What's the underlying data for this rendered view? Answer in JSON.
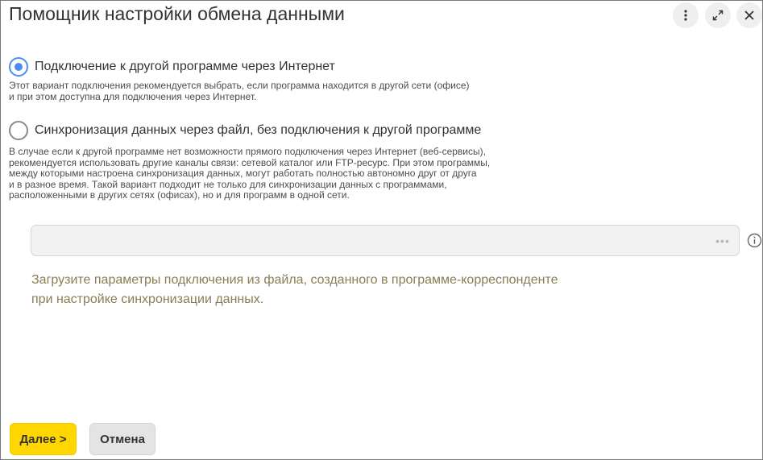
{
  "window": {
    "title": "Помощник настройки обмена данными"
  },
  "header_buttons": {
    "more": "more-vertical-icon",
    "expand": "expand-icon",
    "close": "close-icon"
  },
  "options": [
    {
      "label": "Подключение к другой программе через Интернет",
      "selected": true,
      "description_lines": [
        "Этот вариант подключения рекомендуется выбрать, если программа находится в другой сети (офисе)",
        "и при этом доступна для подключения через Интернет."
      ]
    },
    {
      "label": "Синхронизация данных через файл, без подключения к другой программе",
      "selected": false,
      "description_lines": [
        "В случае если к другой программе нет возможности прямого подключения через Интернет (веб-сервисы),",
        "рекомендуется использовать другие каналы связи: сетевой каталог или FTP-ресурс. При этом программы,",
        "между которыми настроена синхронизация данных, могут работать полностью автономно друг от друга",
        "и в разное время. Такой вариант подходит не только для синхронизации данных с программами,",
        "расположенными в других сетях (офисах), но и для программ в одной сети."
      ]
    }
  ],
  "file_field": {
    "value": "",
    "choose_button": "•••"
  },
  "hint_lines": [
    "Загрузите параметры подключения из файла, созданного в программе-корреспонденте",
    "при настройке синхронизации данных."
  ],
  "footer": {
    "next_label": "Далее >",
    "cancel_label": "Отмена"
  },
  "colors": {
    "accent_radio": "#4a8ff0",
    "primary_button": "#ffd600",
    "hint_text": "#8a7d54"
  }
}
